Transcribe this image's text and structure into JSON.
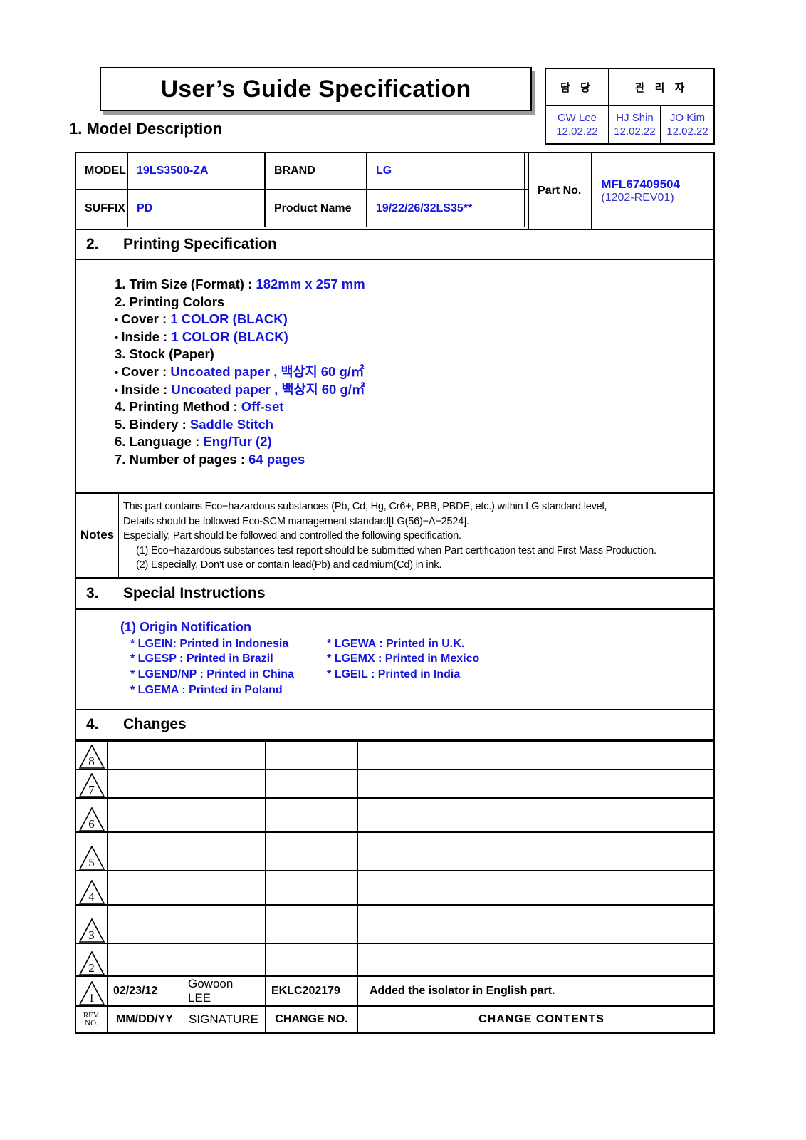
{
  "title": "User’s Guide Specification",
  "section1": {
    "heading": "1. Model Description",
    "model_label": "MODEL",
    "model_value": "19LS3500-ZA",
    "brand_label": "BRAND",
    "brand_value": "LG",
    "suffix_label": "SUFFIX",
    "suffix_value": "PD",
    "product_name_label": "Product Name",
    "product_name_value": "19/22/26/32LS35**",
    "part_no_label": "Part No.",
    "part_no_value": "MFL67409504",
    "part_no_rev": "(1202-REV01)"
  },
  "stamp": {
    "col1_header": "담 당",
    "col2_header": "관 리 자",
    "approvers": [
      {
        "name": "GW Lee",
        "date": "12.02.22"
      },
      {
        "name": "HJ Shin",
        "date": "12.02.22"
      },
      {
        "name": "JO Kim",
        "date": "12.02.22"
      }
    ]
  },
  "section2": {
    "number": "2.",
    "heading": "Printing Specification",
    "lines": [
      {
        "label": "1. Trim Size (Format) : ",
        "value": "182mm x 257 mm",
        "bullet": false
      },
      {
        "label": "2. Printing Colors",
        "value": "",
        "bullet": false
      },
      {
        "label": "Cover : ",
        "value": "1 COLOR (BLACK)",
        "bullet": true
      },
      {
        "label": "Inside : ",
        "value": "1 COLOR (BLACK)",
        "bullet": true
      },
      {
        "label": "3. Stock (Paper)",
        "value": "",
        "bullet": false
      },
      {
        "label": "Cover : ",
        "value": "Uncoated paper , 백상지 60 g/㎡",
        "bullet": true
      },
      {
        "label": "Inside : ",
        "value": "Uncoated paper , 백상지 60 g/㎡",
        "bullet": true
      },
      {
        "label": "4. Printing Method : ",
        "value": "Off-set",
        "bullet": false
      },
      {
        "label": "5. Bindery  : ",
        "value": "Saddle Stitch",
        "bullet": false
      },
      {
        "label": "6. Language : ",
        "value": "Eng/Tur (2)",
        "bullet": false
      },
      {
        "label": "7. Number of pages : ",
        "value": "64 pages",
        "bullet": false
      }
    ]
  },
  "notes": {
    "label": "Notes",
    "lines": [
      "This part contains Eco−hazardous substances (Pb, Cd, Hg, Cr6+, PBB, PBDE, etc.) within LG standard level,",
      "Details should be followed Eco-SCM management standard[LG(56)−A−2524].",
      "Especially, Part should be followed and controlled the following specification.",
      "(1) Eco−hazardous substances test report should be submitted when  Part certification test and First Mass Production.",
      "(2) Especially, Don’t use or contain lead(Pb) and cadmium(Cd) in ink."
    ]
  },
  "section3": {
    "number": "3.",
    "heading": "Special Instructions",
    "subtitle": "(1) Origin Notification",
    "origins": [
      {
        "left": "* LGEIN: Printed in Indonesia",
        "right": "* LGEWA : Printed in U.K."
      },
      {
        "left": "* LGESP : Printed in Brazil",
        "right": "* LGEMX : Printed in Mexico"
      },
      {
        "left": "* LGEND/NP : Printed in China",
        "right": " * LGEIL : Printed in India"
      },
      {
        "left": "* LGEMA : Printed in Poland",
        "right": ""
      }
    ]
  },
  "section4": {
    "number": "4.",
    "heading": "Changes",
    "rows": [
      {
        "rev": "8",
        "date": "",
        "signature": "",
        "change_no": "",
        "contents": ""
      },
      {
        "rev": "7",
        "date": "",
        "signature": "",
        "change_no": "",
        "contents": ""
      },
      {
        "rev": "6",
        "date": "",
        "signature": "",
        "change_no": "",
        "contents": ""
      },
      {
        "rev": "5",
        "date": "",
        "signature": "",
        "change_no": "",
        "contents": ""
      },
      {
        "rev": "4",
        "date": "",
        "signature": "",
        "change_no": "",
        "contents": ""
      },
      {
        "rev": "3",
        "date": "",
        "signature": "",
        "change_no": "",
        "contents": ""
      },
      {
        "rev": "2",
        "date": "",
        "signature": "",
        "change_no": "",
        "contents": ""
      },
      {
        "rev": "1",
        "date": "02/23/12",
        "signature": "Gowoon LEE",
        "change_no": "EKLC202179",
        "contents": "Added the isolator in English part."
      }
    ],
    "footer": {
      "rev_line1": "REV.",
      "rev_line2": "NO.",
      "date": "MM/DD/YY",
      "signature": "SIGNATURE",
      "change_no": "CHANGE NO.",
      "contents": "CHANGE   CONTENTS"
    }
  },
  "colors": {
    "accent_blue": "#1414dc",
    "stamp_blue": "#3333cc",
    "line": "#000000"
  }
}
